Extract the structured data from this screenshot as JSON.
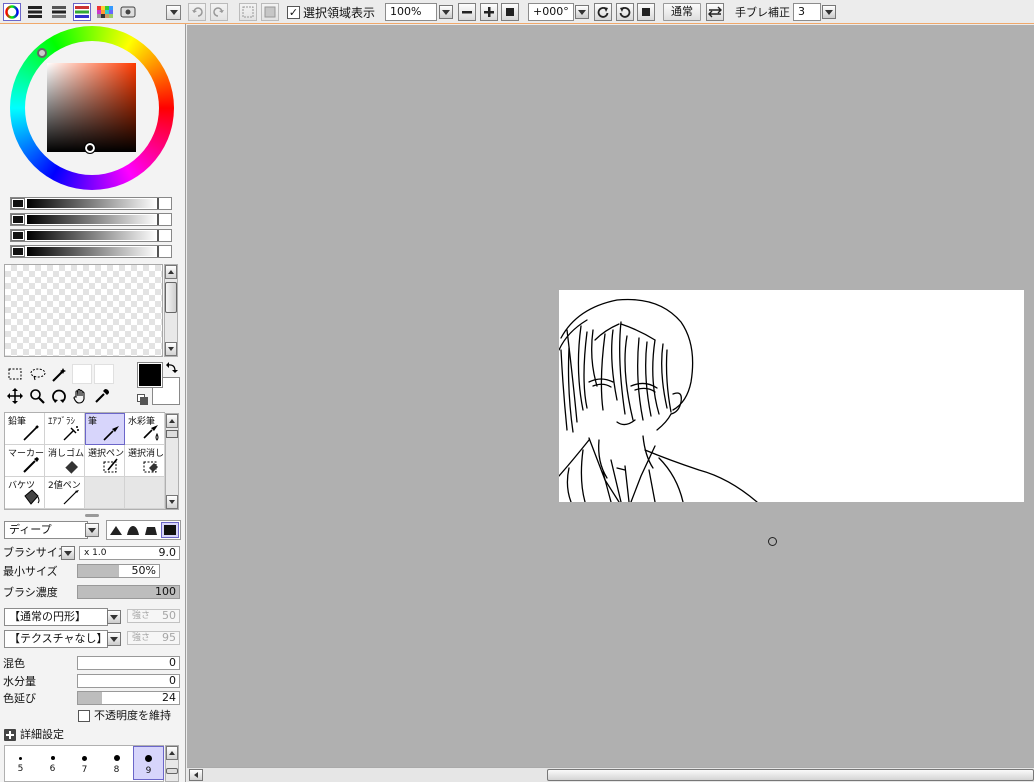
{
  "toolbar": {
    "show_selection_label": "選択領域表示",
    "show_selection_checked": true,
    "zoom_value": "100%",
    "rotation_value": "+000°",
    "blend_mode_label": "通常",
    "stabilizer_label": "手ブレ補正",
    "stabilizer_value": "3"
  },
  "tools": [
    {
      "label": "鉛筆",
      "icon": "pencil-icon"
    },
    {
      "label": "ｴｱﾌﾞﾗｼ",
      "icon": "airbrush-icon"
    },
    {
      "label": "筆",
      "icon": "brush-icon",
      "selected": true
    },
    {
      "label": "水彩筆",
      "icon": "watercolor-brush-icon"
    },
    {
      "label": "マーカー",
      "icon": "marker-icon"
    },
    {
      "label": "消しゴム",
      "icon": "eraser-icon"
    },
    {
      "label": "選択ペン",
      "icon": "selection-pen-icon"
    },
    {
      "label": "選択消し",
      "icon": "selection-eraser-icon"
    },
    {
      "label": "バケツ",
      "icon": "bucket-icon"
    },
    {
      "label": "2値ペン",
      "icon": "binary-pen-icon"
    }
  ],
  "brush": {
    "shape_mode": "ディープ",
    "size_label": "ブラシサイズ",
    "size_multiplier": "x 1.0",
    "size_value": "9.0",
    "min_size_label": "最小サイズ",
    "min_size_value": "50%",
    "min_size_fraction": 0.5,
    "density_label": "ブラシ濃度",
    "density_value": "100",
    "density_fraction": 1.0,
    "shape_preset": "【通常の円形】",
    "shape_strength_label": "強さ",
    "shape_strength_value": "50",
    "texture_preset": "【テクスチャなし】",
    "texture_strength_label": "強さ",
    "texture_strength_value": "95",
    "blend_label": "混色",
    "blend_value": "0",
    "water_label": "水分量",
    "water_value": "0",
    "color_stretch_label": "色延び",
    "color_stretch_value": "24",
    "color_stretch_fraction": 0.24,
    "keep_opacity_label": "不透明度を維持",
    "keep_opacity_checked": false,
    "advanced_label": "詳細設定"
  },
  "size_presets": [
    "5",
    "6",
    "7",
    "8",
    "9"
  ],
  "selected_size_preset": "9",
  "colors": {
    "primary": "#000000",
    "secondary": "#ffffff",
    "canvas_bg": "#b0b0b0",
    "selection_accent": "#d7d5fb",
    "selection_border": "#6b66c9"
  }
}
